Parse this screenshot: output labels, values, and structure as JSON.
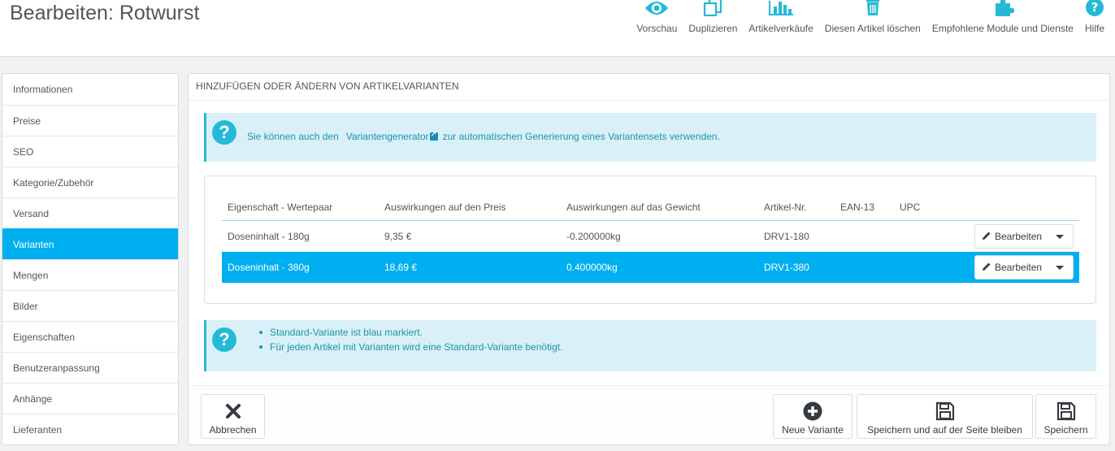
{
  "header": {
    "title": "Bearbeiten: Rotwurst",
    "toolbar": [
      {
        "label": "Vorschau",
        "icon": "eye-icon"
      },
      {
        "label": "Duplizieren",
        "icon": "copy-icon"
      },
      {
        "label": "Artikelverkäufe",
        "icon": "bar-chart-icon"
      },
      {
        "label": "Diesen Artikel löschen",
        "icon": "trash-icon"
      },
      {
        "label": "Empfohlene Module und Dienste",
        "icon": "puzzle-icon"
      },
      {
        "label": "Hilfe",
        "icon": "help-icon"
      }
    ]
  },
  "sidebar": {
    "items": [
      {
        "label": "Informationen"
      },
      {
        "label": "Preise"
      },
      {
        "label": "SEO"
      },
      {
        "label": "Kategorie/Zubehör"
      },
      {
        "label": "Versand"
      },
      {
        "label": "Varianten",
        "active": true
      },
      {
        "label": "Mengen"
      },
      {
        "label": "Bilder"
      },
      {
        "label": "Eigenschaften"
      },
      {
        "label": "Benutzeranpassung"
      },
      {
        "label": "Anhänge"
      },
      {
        "label": "Lieferanten"
      }
    ]
  },
  "panel": {
    "heading": "Hinzufügen oder Ändern von Artikelvarianten",
    "info": {
      "before": "Sie können auch den",
      "link": "Variantengenerator",
      "after": "zur automatischen Generierung eines Variantensets verwenden."
    },
    "table": {
      "headers": [
        "Eigenschaft - Wertepaar",
        "Auswirkungen auf den Preis",
        "Auswirkungen auf das Gewicht",
        "Artikel-Nr.",
        "EAN-13",
        "UPC"
      ],
      "rows": [
        {
          "attribute": "Doseninhalt - 180g",
          "price": "9,35 €",
          "weight": "-0.200000kg",
          "reference": "DRV1-180",
          "ean13": "",
          "upc": "",
          "action": "Bearbeiten",
          "default": false
        },
        {
          "attribute": "Doseninhalt - 380g",
          "price": "18,69 €",
          "weight": "0.400000kg",
          "reference": "DRV1-380",
          "ean13": "",
          "upc": "",
          "action": "Bearbeiten",
          "default": true
        }
      ]
    },
    "notes": [
      "Standard-Variante ist blau markiert.",
      "Für jeden Artikel mit Varianten wird eine Standard-Variante benötigt."
    ]
  },
  "footer": {
    "cancel": "Abbrechen",
    "new_variant": "Neue Variante",
    "save_stay": "Speichern und auf der Seite bleiben",
    "save": "Speichern"
  },
  "colors": {
    "accent": "#00aff0",
    "info_bg": "#d9f0f8",
    "info_icon": "#25b9d7"
  }
}
